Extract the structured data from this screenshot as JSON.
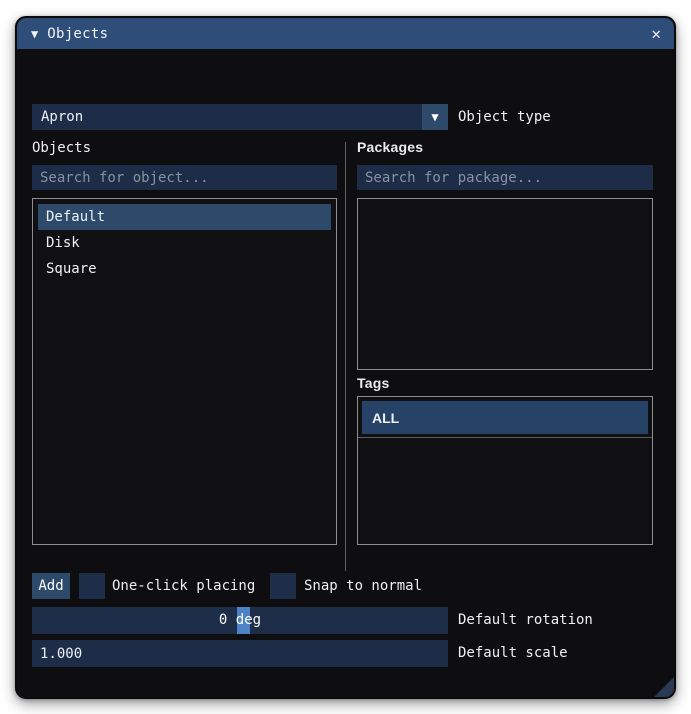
{
  "window": {
    "title": "Objects",
    "collapse_icon": "▼",
    "close_icon": "✕"
  },
  "object_type": {
    "value": "Apron",
    "dropdown_icon": "▼",
    "label": "Object type"
  },
  "objects": {
    "label": "Objects",
    "search_placeholder": "Search for object...",
    "items": [
      {
        "label": "Default",
        "selected": true
      },
      {
        "label": "Disk",
        "selected": false
      },
      {
        "label": "Square",
        "selected": false
      }
    ]
  },
  "packages": {
    "label": "Packages",
    "search_placeholder": "Search for package...",
    "items": []
  },
  "tags": {
    "label": "Tags",
    "items": [
      {
        "label": "ALL",
        "selected": true
      }
    ]
  },
  "actions": {
    "add_label": "Add",
    "one_click_label": "One-click placing",
    "one_click_checked": false,
    "snap_label": "Snap to normal",
    "snap_checked": false
  },
  "defaults": {
    "rotation_value": "0 deg",
    "rotation_label": "Default rotation",
    "scale_value": "1.000",
    "scale_label": "Default scale"
  },
  "colors": {
    "titlebar": "#2e4d78",
    "panel_background": "#0e0e10",
    "field_background": "#1d2c47",
    "selection_accent": "#2d4a6b",
    "slider_handle": "#4d82c6",
    "placeholder_text": "#8893a0"
  }
}
